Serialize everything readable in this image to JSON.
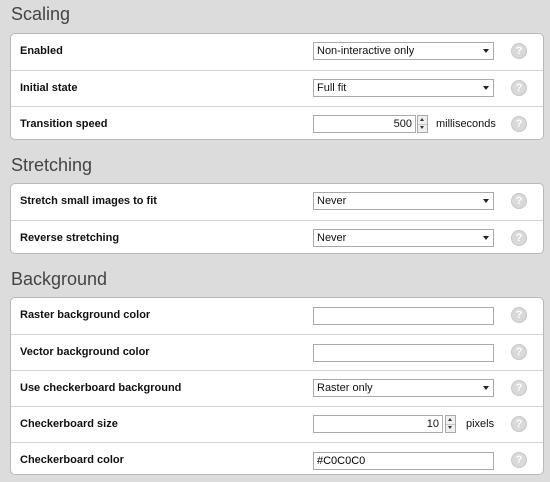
{
  "sections": {
    "scaling": {
      "title": "Scaling",
      "enabled": {
        "label": "Enabled",
        "value": "Non-interactive only"
      },
      "initial_state": {
        "label": "Initial state",
        "value": "Full fit"
      },
      "transition_speed": {
        "label": "Transition speed",
        "value": "500",
        "unit": "milliseconds"
      }
    },
    "stretching": {
      "title": "Stretching",
      "stretch_small": {
        "label": "Stretch small images to fit",
        "value": "Never"
      },
      "reverse_stretching": {
        "label": "Reverse stretching",
        "value": "Never"
      }
    },
    "background": {
      "title": "Background",
      "raster_color": {
        "label": "Raster background color",
        "value": ""
      },
      "vector_color": {
        "label": "Vector background color",
        "value": ""
      },
      "use_checkerboard": {
        "label": "Use checkerboard background",
        "value": "Raster only"
      },
      "checkerboard_size": {
        "label": "Checkerboard size",
        "value": "10",
        "unit": "pixels"
      },
      "checkerboard_color": {
        "label": "Checkerboard color",
        "value": "#C0C0C0"
      }
    }
  },
  "help_glyph": "?",
  "icons": {
    "help": "question-circle-icon",
    "dropdown": "chevron-down-icon",
    "spinner": "spinner-arrows-icon"
  },
  "colors": {
    "page_bg": "#dcdcdc",
    "panel_bg": "#ffffff",
    "panel_border": "#b9b9b9",
    "help_icon": "#d9d9d9"
  }
}
